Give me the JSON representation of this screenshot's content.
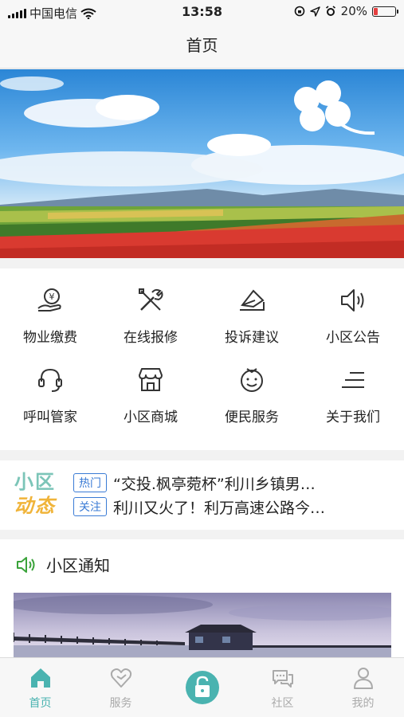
{
  "status_bar": {
    "carrier": "中国电信",
    "time": "13:58",
    "battery_percent": "20%",
    "battery_level": 0.2
  },
  "nav": {
    "title": "首页"
  },
  "services": [
    {
      "label": "物业缴费",
      "icon": "payment-icon"
    },
    {
      "label": "在线报修",
      "icon": "repair-tools-icon"
    },
    {
      "label": "投诉建议",
      "icon": "complaint-envelope-icon"
    },
    {
      "label": "小区公告",
      "icon": "speaker-icon"
    },
    {
      "label": "呼叫管家",
      "icon": "headset-icon"
    },
    {
      "label": "小区商城",
      "icon": "store-icon"
    },
    {
      "label": "便民服务",
      "icon": "service-face-icon"
    },
    {
      "label": "关于我们",
      "icon": "menu-lines-icon"
    }
  ],
  "news": {
    "logo_line1": "小区",
    "logo_line2": "动态",
    "items": [
      {
        "tag": "热门",
        "text": "“交投.枫亭菀杯”利川乡镇男…"
      },
      {
        "tag": "关注",
        "text": "利川又火了！利万高速公路今…"
      }
    ]
  },
  "notice": {
    "title": "小区通知"
  },
  "tabs": [
    {
      "label": "首页",
      "icon": "home-icon",
      "active": true
    },
    {
      "label": "服务",
      "icon": "heart-icon",
      "active": false
    },
    {
      "label": "",
      "icon": "unlock-icon",
      "active": false
    },
    {
      "label": "社区",
      "icon": "chat-bubbles-icon",
      "active": false
    },
    {
      "label": "我的",
      "icon": "user-icon",
      "active": false
    }
  ],
  "colors": {
    "accent": "#4ab3b0",
    "tag_blue": "#3a7bd5",
    "logo_green": "#7cc5b8",
    "logo_orange": "#f0b43a"
  }
}
